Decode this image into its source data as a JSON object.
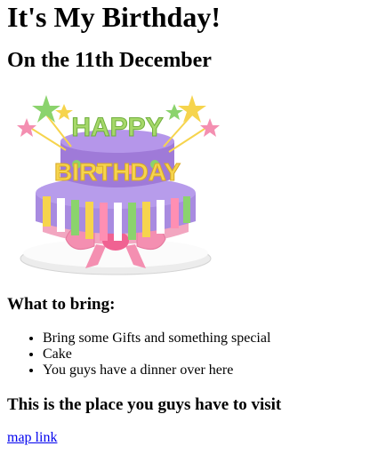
{
  "page": {
    "title": "It's My Birthday!",
    "date_heading": "On the 11th December",
    "cake_image": {
      "top_text": "HAPPY",
      "bottom_text": "BIRTHDAY",
      "icon": "birthday-cake-icon"
    },
    "bring": {
      "heading": "What to bring:",
      "items": [
        {
          "label": "Bring some Gifts and something special"
        },
        {
          "label": "Cake"
        },
        {
          "label": "You guys have a dinner over here"
        }
      ]
    },
    "visit": {
      "heading": "This is the place you guys have to visit",
      "link_label": "map link"
    }
  },
  "colors": {
    "link": "#0000ee",
    "text": "#000000",
    "background": "#ffffff"
  }
}
